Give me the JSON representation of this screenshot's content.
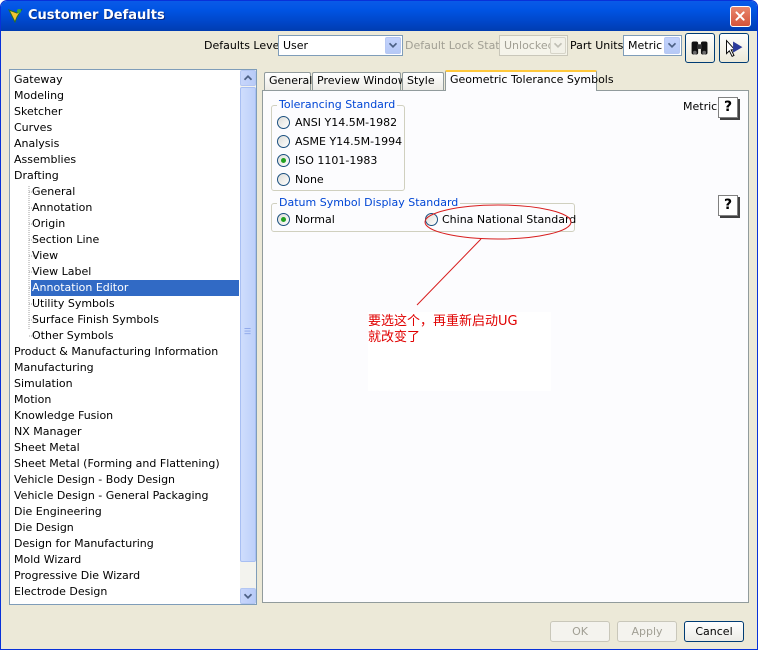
{
  "window": {
    "title": "Customer Defaults"
  },
  "toolbar": {
    "defaults_level_label": "Defaults Level",
    "defaults_level_value": "User",
    "lock_state_label": "Default Lock State",
    "lock_state_value": "Unlocked",
    "part_units_label": "Part Units",
    "part_units_value": "Metric"
  },
  "tree": {
    "items": [
      {
        "label": "Gateway",
        "level": 0
      },
      {
        "label": "Modeling",
        "level": 0
      },
      {
        "label": "Sketcher",
        "level": 0
      },
      {
        "label": "Curves",
        "level": 0
      },
      {
        "label": "Analysis",
        "level": 0
      },
      {
        "label": "Assemblies",
        "level": 0
      },
      {
        "label": "Drafting",
        "level": 0
      },
      {
        "label": "General",
        "level": 1
      },
      {
        "label": "Annotation",
        "level": 1
      },
      {
        "label": "Origin",
        "level": 1
      },
      {
        "label": "Section Line",
        "level": 1
      },
      {
        "label": "View",
        "level": 1
      },
      {
        "label": "View Label",
        "level": 1
      },
      {
        "label": "Annotation Editor",
        "level": 1,
        "selected": true
      },
      {
        "label": "Utility Symbols",
        "level": 1
      },
      {
        "label": "Surface Finish Symbols",
        "level": 1
      },
      {
        "label": "Other Symbols",
        "level": 1
      },
      {
        "label": "Product & Manufacturing Information",
        "level": 0
      },
      {
        "label": "Manufacturing",
        "level": 0
      },
      {
        "label": "Simulation",
        "level": 0
      },
      {
        "label": "Motion",
        "level": 0
      },
      {
        "label": "Knowledge Fusion",
        "level": 0
      },
      {
        "label": "NX Manager",
        "level": 0
      },
      {
        "label": "Sheet Metal",
        "level": 0
      },
      {
        "label": "Sheet Metal (Forming and Flattening)",
        "level": 0
      },
      {
        "label": "Vehicle Design - Body Design",
        "level": 0
      },
      {
        "label": "Vehicle Design - General Packaging",
        "level": 0
      },
      {
        "label": "Die Engineering",
        "level": 0
      },
      {
        "label": "Die Design",
        "level": 0
      },
      {
        "label": "Design for Manufacturing",
        "level": 0
      },
      {
        "label": "Mold Wizard",
        "level": 0
      },
      {
        "label": "Progressive Die Wizard",
        "level": 0
      },
      {
        "label": "Electrode Design",
        "level": 0
      }
    ]
  },
  "tabs": [
    {
      "label": "General"
    },
    {
      "label": "Preview Window"
    },
    {
      "label": "Style"
    },
    {
      "label": "Geometric Tolerance Symbols",
      "active": true
    }
  ],
  "panel": {
    "units_label": "Metric",
    "help_glyph": "?",
    "tolerancing": {
      "title": "Tolerancing Standard",
      "options": [
        "ANSI Y14.5M-1982",
        "ASME Y14.5M-1994",
        "ISO  1101-1983",
        "None"
      ],
      "selected_index": 2
    },
    "datum": {
      "title": "Datum Symbol Display Standard",
      "options": [
        "Normal",
        "China National Standard"
      ],
      "selected_index": 0
    }
  },
  "annotation": {
    "line1": "要选这个，再重新启动UG",
    "line2": "就改变了",
    "color": "#e00000"
  },
  "footer": {
    "ok": "OK",
    "apply": "Apply",
    "cancel": "Cancel"
  },
  "icons": {
    "app": "nx-app-icon",
    "close": "close-icon",
    "find": "binoculars-icon",
    "whats_this": "whats-this-icon",
    "help": "help-icon"
  }
}
